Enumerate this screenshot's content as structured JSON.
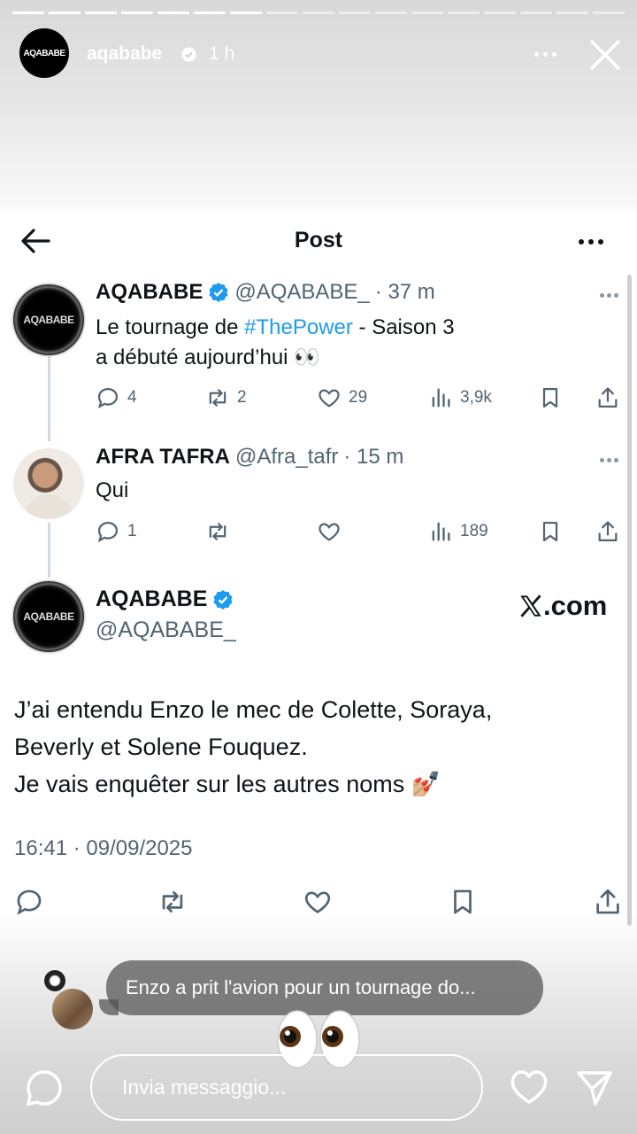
{
  "story": {
    "segments": 17,
    "done_segments": 7,
    "username": "aqababe",
    "time": "1 h",
    "avatar_text": "AQABABE"
  },
  "post_header": {
    "title": "Post"
  },
  "tweets": [
    {
      "name": "AQABABE",
      "handle": "@AQABABE_",
      "time": "· 37 m",
      "text_before": "Le tournage de ",
      "hashtag": "#ThePower",
      "text_after": " - Saison 3",
      "line2": "a débuté aujourd’hui 👀",
      "reply_count": "4",
      "retweet_count": "2",
      "like_count": "29",
      "views_count": "3,9k"
    },
    {
      "name": "AFRA TAFRA",
      "handle": "@Afra_tafr",
      "time": "· 15 m",
      "text": "Qui",
      "reply_count": "1",
      "retweet_count": "",
      "like_count": "",
      "views_count": "189"
    }
  ],
  "main_tweet": {
    "name": "AQABABE",
    "handle": "@AQABABE_",
    "brand": ".com",
    "line1": "J’ai entendu Enzo le mec de Colette, Soraya,",
    "line2": "Beverly et Solene Fouquez.",
    "line3": "Je vais enquêter sur les autres noms 💅🏼",
    "date": "16:41 · 09/09/2025"
  },
  "reply_bubble": {
    "text": "Enzo a prit l'avion pour un tournage do..."
  },
  "bottom_bar": {
    "placeholder": "Invia messaggio..."
  },
  "colors": {
    "accent": "#1d9bf0",
    "text": "#0f1419",
    "muted": "#536471"
  },
  "icons": [
    "verified-badge-icon",
    "more-icon",
    "close-icon",
    "back-arrow-icon",
    "reply-icon",
    "retweet-icon",
    "like-icon",
    "views-icon",
    "bookmark-icon",
    "share-icon",
    "x-logo-icon",
    "eyes-emoji-icon",
    "camera-icon",
    "heart-icon",
    "send-icon"
  ]
}
